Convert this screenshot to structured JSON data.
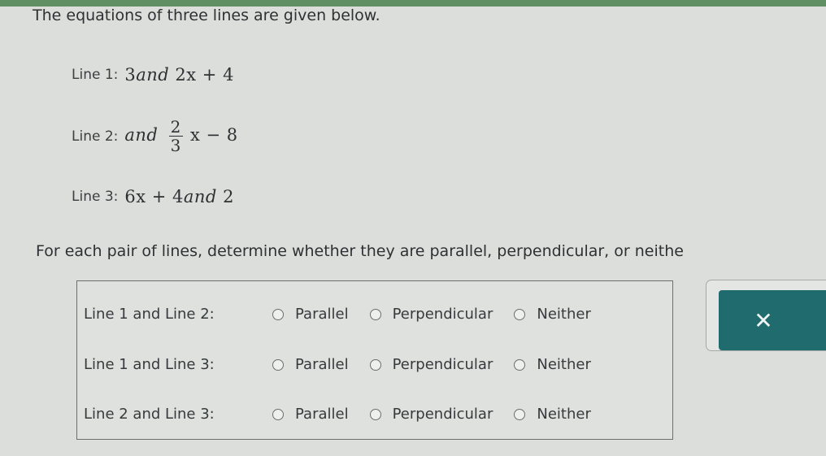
{
  "question": {
    "intro": "The equations of three lines are given below.",
    "lines": [
      {
        "label": "Line 1:",
        "parts": [
          "3",
          "and",
          " 2x + 4"
        ]
      },
      {
        "label": "Line 2:",
        "and": "and",
        "frac_num": "2",
        "frac_den": "3",
        "rest": "x − 8"
      },
      {
        "label": "Line 3:",
        "parts": [
          "6x + 4",
          "and",
          " 2"
        ]
      }
    ],
    "instruction": "For each pair of lines, determine whether they are parallel, perpendicular, or neithe"
  },
  "answers": {
    "pairs": [
      {
        "label": "Line 1 and Line 2:",
        "options": [
          "Parallel",
          "Perpendicular",
          "Neither"
        ],
        "selected": null
      },
      {
        "label": "Line 1 and Line 3:",
        "options": [
          "Parallel",
          "Perpendicular",
          "Neither"
        ],
        "selected": null
      },
      {
        "label": "Line 2 and Line 3:",
        "options": [
          "Parallel",
          "Perpendicular",
          "Neither"
        ],
        "selected": null
      }
    ]
  },
  "side": {
    "clear_icon": "close-icon",
    "clear_glyph": "✕"
  },
  "colors": {
    "accent": "#1f6b6e",
    "topbar": "#5f8f62"
  }
}
